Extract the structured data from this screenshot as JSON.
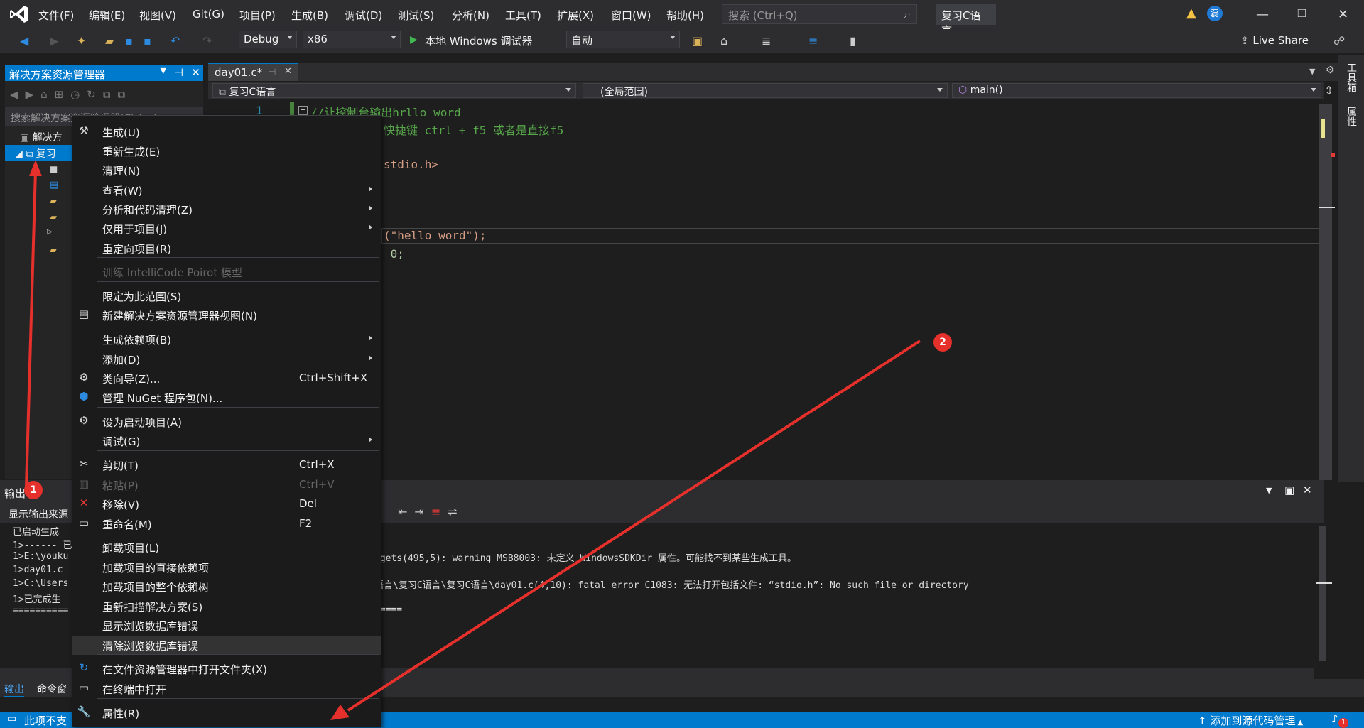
{
  "menubar": {
    "items": [
      "文件(F)",
      "编辑(E)",
      "视图(V)",
      "Git(G)",
      "项目(P)",
      "生成(B)",
      "调试(D)",
      "测试(S)",
      "分析(N)",
      "工具(T)",
      "扩展(X)",
      "窗口(W)",
      "帮助(H)"
    ],
    "search_placeholder": "搜索 (Ctrl+Q)",
    "solution_title": "复习C语言",
    "avatar": "磊"
  },
  "toolbar": {
    "config": "Debug",
    "platform": "x86",
    "run_label": "本地 Windows 调试器",
    "auto": "自动",
    "liveshare": "Live Share"
  },
  "solution_explorer": {
    "title": "解决方案资源管理器",
    "search_placeholder": "搜索解决方案资源管理器(Ctrl+;)",
    "solution_item": "解决方",
    "project_item": "复习"
  },
  "editor": {
    "tab": "day01.c*",
    "nav_project": "复习C语言",
    "nav_scope": "(全局范围)",
    "nav_func": "main()",
    "line_number": "1",
    "lines": [
      "//让控制台输出hrllo word",
      "快捷键 ctrl + f5 或者是直接f5",
      "stdio.h>",
      "(\"hello word\");",
      " 0;"
    ]
  },
  "right_rail": [
    "工具箱",
    "属性"
  ],
  "output": {
    "title": "输出",
    "source_label": "显示输出来源",
    "left_lines": [
      "已启动生成",
      "1>------ 已",
      "1>E:\\youku",
      "1>day01.c",
      "1>C:\\Users",
      "1>已完成生",
      "=========="
    ],
    "right_lines": [
      "rgets(495,5): warning MSB8003: 未定义 WindowsSDKDir 属性。可能找不到某些生成工具。",
      "语言\\复习C语言\\复习C语言\\day01.c(4,10): fatal error C1083: 无法打开包括文件: “stdio.h”: No such file or directory",
      "====="
    ],
    "tabs": [
      "输出",
      "命令窗"
    ]
  },
  "context_menu": {
    "items": [
      {
        "label": "生成(U)",
        "icon": "build-icon"
      },
      {
        "label": "重新生成(E)"
      },
      {
        "label": "清理(N)"
      },
      {
        "label": "查看(W)",
        "submenu": true
      },
      {
        "label": "分析和代码清理(Z)",
        "submenu": true
      },
      {
        "label": "仅用于项目(J)",
        "submenu": true
      },
      {
        "label": "重定向项目(R)"
      },
      {
        "label": "训练 IntelliCode Poirot 模型",
        "disabled": true
      },
      {
        "label": "限定为此范围(S)"
      },
      {
        "label": "新建解决方案资源管理器视图(N)",
        "icon": "new-view-icon"
      },
      {
        "label": "生成依赖项(B)",
        "submenu": true
      },
      {
        "label": "添加(D)",
        "submenu": true
      },
      {
        "label": "类向导(Z)...",
        "shortcut": "Ctrl+Shift+X",
        "icon": "class-wizard-icon"
      },
      {
        "label": "管理 NuGet 程序包(N)...",
        "icon": "nuget-icon"
      },
      {
        "label": "设为启动项目(A)",
        "icon": "gear-icon"
      },
      {
        "label": "调试(G)",
        "submenu": true
      },
      {
        "label": "剪切(T)",
        "shortcut": "Ctrl+X",
        "icon": "scissors-icon"
      },
      {
        "label": "粘贴(P)",
        "shortcut": "Ctrl+V",
        "disabled": true,
        "icon": "paste-icon"
      },
      {
        "label": "移除(V)",
        "shortcut": "Del",
        "icon": "close-icon"
      },
      {
        "label": "重命名(M)",
        "shortcut": "F2",
        "icon": "rename-icon"
      },
      {
        "label": "卸载项目(L)"
      },
      {
        "label": "加载项目的直接依赖项"
      },
      {
        "label": "加载项目的整个依赖树"
      },
      {
        "label": "重新扫描解决方案(S)"
      },
      {
        "label": "显示浏览数据库错误"
      },
      {
        "label": "清除浏览数据库错误",
        "highlight": true
      },
      {
        "label": "在文件资源管理器中打开文件夹(X)",
        "icon": "refresh-icon"
      },
      {
        "label": "在终端中打开",
        "icon": "terminal-icon"
      },
      {
        "label": "属性(R)",
        "icon": "wrench-icon"
      }
    ]
  },
  "annotations": [
    "1",
    "2"
  ],
  "statusbar": {
    "left": "此项不支",
    "right": "添加到源代码管理",
    "bell_count": "1"
  }
}
